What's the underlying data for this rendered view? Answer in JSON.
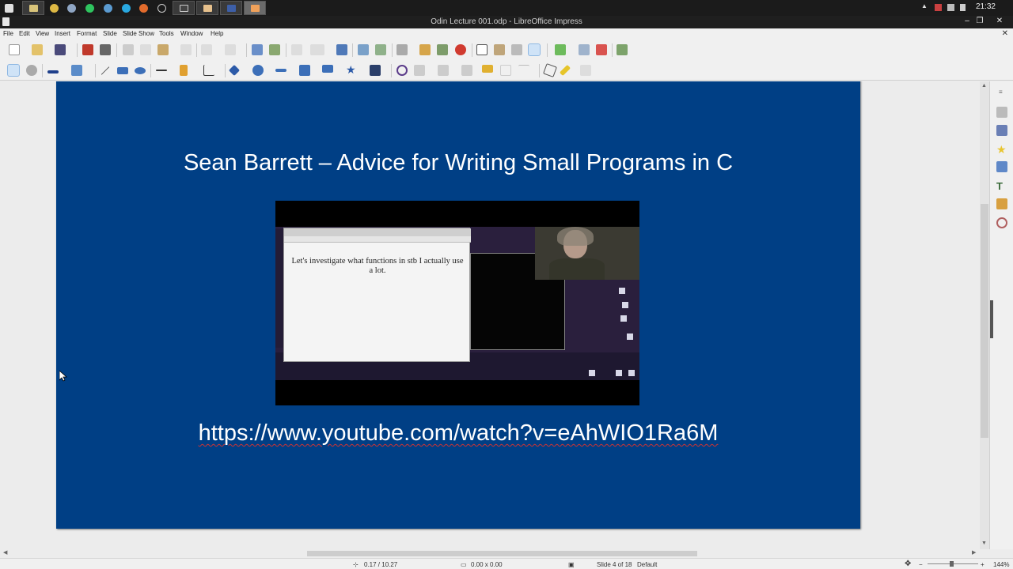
{
  "window": {
    "title": "Odin Lecture 001.odp - LibreOffice Impress",
    "clock": "21:32"
  },
  "menu": [
    "File",
    "Edit",
    "View",
    "Insert",
    "Format",
    "Slide",
    "Slide Show",
    "Tools",
    "Window",
    "Help"
  ],
  "slide": {
    "title": "Sean Barrett – Advice for Writing Small Programs in C",
    "url": "https://www.youtube.com/watch?v=eAhWIO1Ra6M",
    "video_text": "Let's investigate what functions in stb I actually use a lot."
  },
  "status": {
    "position": "0.17 / 10.27",
    "size": "0.00 x 0.00",
    "slide_counter": "Slide 4 of 18",
    "layout": "Default",
    "zoom": "144%"
  },
  "colors": {
    "slide_background": "#003f85",
    "title_bar": "#1f1f1f"
  }
}
